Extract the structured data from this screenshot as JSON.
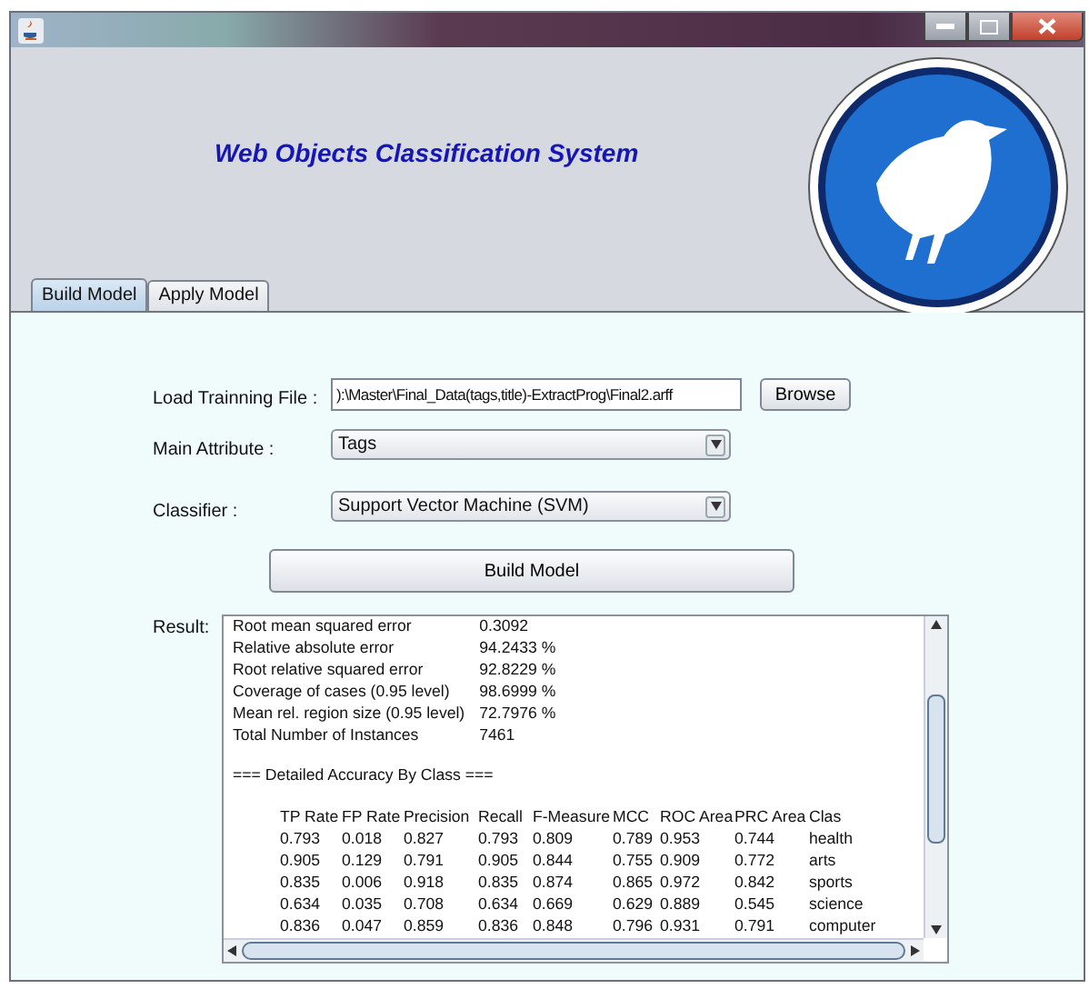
{
  "header": {
    "title": "Web Objects Classification System"
  },
  "tabs": [
    {
      "label": "Build Model",
      "selected": true
    },
    {
      "label": "Apply Model",
      "selected": false
    }
  ],
  "form": {
    "training_file": {
      "label": "Load Trainning File :",
      "value": "):\\Master\\Final_Data(tags,title)-ExtractProg\\Final2.arff",
      "button": "Browse"
    },
    "main_attribute": {
      "label": "Main Attribute :",
      "value": "Tags"
    },
    "classifier": {
      "label": "Classifier :",
      "value": "Support Vector Machine (SVM)"
    },
    "build_button": "Build Model"
  },
  "result": {
    "label": "Result:",
    "summary": [
      {
        "label": "Root mean squared error",
        "value": "0.3092"
      },
      {
        "label": "Relative absolute error",
        "value": "94.2433 %"
      },
      {
        "label": "Root relative squared error",
        "value": "92.8229 %"
      },
      {
        "label": "Coverage of cases (0.95 level)",
        "value": "98.6999 %"
      },
      {
        "label": "Mean rel. region size (0.95 level)",
        "value": "72.7976 %"
      },
      {
        "label": "Total Number of Instances",
        "value": "7461"
      }
    ],
    "section_heading": "=== Detailed Accuracy By Class ===",
    "columns": [
      "TP Rate",
      "FP Rate",
      "Precision",
      "Recall",
      "F-Measure",
      "MCC",
      "ROC Area",
      "PRC Area",
      "Clas"
    ],
    "rows": [
      [
        "0.793",
        "0.018",
        "0.827",
        "0.793",
        "0.809",
        "0.789",
        "0.953",
        "0.744",
        "health"
      ],
      [
        "0.905",
        "0.129",
        "0.791",
        "0.905",
        "0.844",
        "0.755",
        "0.909",
        "0.772",
        "arts"
      ],
      [
        "0.835",
        "0.006",
        "0.918",
        "0.835",
        "0.874",
        "0.865",
        "0.972",
        "0.842",
        "sports"
      ],
      [
        "0.634",
        "0.035",
        "0.708",
        "0.634",
        "0.669",
        "0.629",
        "0.889",
        "0.545",
        "science"
      ],
      [
        "0.836",
        "0.047",
        "0.859",
        "0.836",
        "0.848",
        "0.796",
        "0.931",
        "0.791",
        "computer"
      ]
    ]
  }
}
